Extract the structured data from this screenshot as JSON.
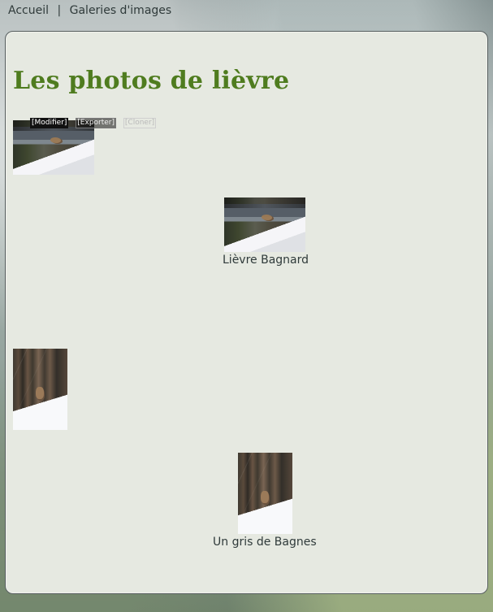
{
  "breadcrumb": {
    "home": "Accueil",
    "separator": "|",
    "gallery": "Galeries d'images"
  },
  "page": {
    "title": "Les photos de lièvre"
  },
  "edit_tools": {
    "modify": "[Modifier]",
    "export": "[Exporter]",
    "clone": "[Cloner]"
  },
  "gallery": {
    "items": [
      {
        "caption": "Lièvre Bagnard",
        "image_icon": "hare-landscape-photo"
      },
      {
        "caption": "Un gris de Bagnes",
        "image_icon": "hare-portrait-photo"
      }
    ]
  },
  "colors": {
    "title": "#4f7c1f",
    "panel_background": "#e6e9e1",
    "text": "#2f3a3a"
  }
}
